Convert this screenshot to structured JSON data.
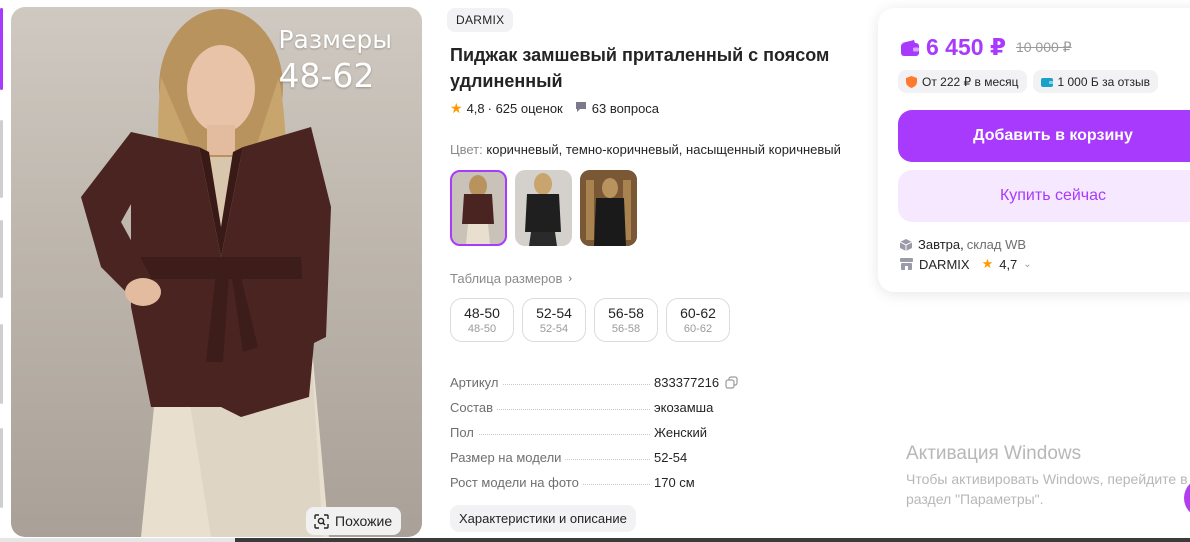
{
  "gallery": {
    "overlay_line1": "Размеры",
    "overlay_line2": "48-62",
    "similar_label": "Похожие"
  },
  "product": {
    "brand": "DARMIX",
    "title": "Пиджак замшевый приталенный с поясом удлиненный",
    "rating": "4,8",
    "reviews": "· 625 оценок",
    "questions": "63 вопроса",
    "color_label": "Цвет:",
    "color_value": "коричневый, темно-коричневый, насыщенный коричневый",
    "size_table_label": "Таблица размеров",
    "sizes": [
      {
        "main": "48-50",
        "sub": "48-50"
      },
      {
        "main": "52-54",
        "sub": "52-54"
      },
      {
        "main": "56-58",
        "sub": "56-58"
      },
      {
        "main": "60-62",
        "sub": "60-62"
      }
    ],
    "specs": [
      {
        "key": "Артикул",
        "value": "833377216"
      },
      {
        "key": "Состав",
        "value": "экозамша"
      },
      {
        "key": "Пол",
        "value": "Женский"
      },
      {
        "key": "Размер на модели",
        "value": "52-54"
      },
      {
        "key": "Рост модели на фото",
        "value": "170 см"
      }
    ],
    "characteristics_button": "Характеристики и описание"
  },
  "buy": {
    "price": "6 450 ₽",
    "old_price": "10 000 ₽",
    "installment": "От 222 ₽ в месяц",
    "review_bonus": "1 000 Б за отзыв",
    "add_to_cart": "Добавить в корзину",
    "buy_now": "Купить сейчас",
    "delivery_day": "Завтра,",
    "delivery_wh": "склад WB",
    "seller_name": "DARMIX",
    "seller_rating": "4,7"
  },
  "windows": {
    "title": "Активация Windows",
    "text": "Чтобы активировать Windows, перейдите в раздел \"Параметры\"."
  },
  "colors": {
    "accent": "#a73afd",
    "accent_light": "#f6e9ff",
    "star": "#ff9a00",
    "jacket": "#4a2420"
  }
}
